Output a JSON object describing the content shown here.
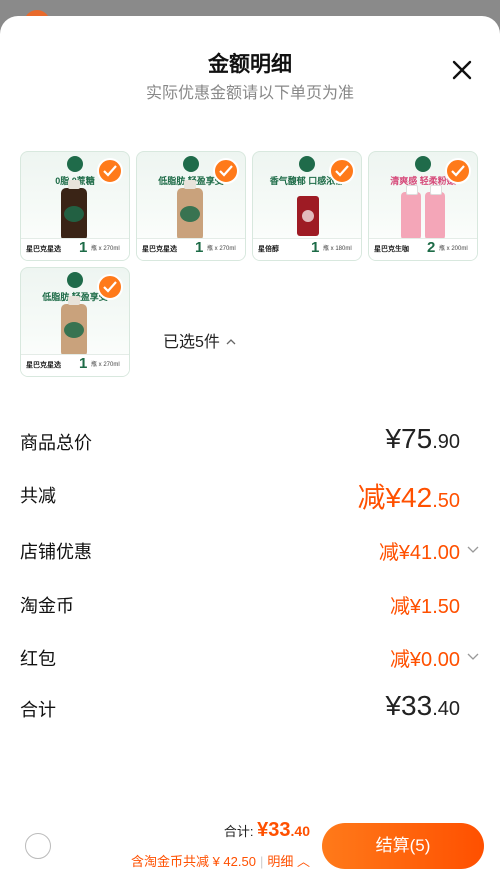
{
  "header": {
    "title": "金额明细",
    "subtitle": "实际优惠金额请以下单页为准",
    "close_icon": "close-icon"
  },
  "products": [
    {
      "banner": "0脂 0蔗糖",
      "brand": "星巴克星选",
      "qty": "1",
      "spec": "瓶 x 270ml",
      "color": "#3a2416"
    },
    {
      "banner": "低脂肪 轻盈享受",
      "brand": "星巴克星选",
      "qty": "1",
      "spec": "瓶 x 270ml",
      "color": "#c9a27c"
    },
    {
      "banner": "香气馥郁 口感浓郁",
      "brand": "星倍醇",
      "qty": "1",
      "spec": "瓶 x 180ml",
      "color": "#9e1b24"
    },
    {
      "banner": "清爽感 轻柔粉嫩",
      "brand": "星巴克生咖",
      "qty": "2",
      "spec": "瓶 x 200ml",
      "color": "#f4a6b8"
    },
    {
      "banner": "低脂肪 轻盈享受",
      "brand": "星巴克星选",
      "qty": "1",
      "spec": "瓶 x 270ml",
      "color": "#c9a27c"
    }
  ],
  "selected_text": "已选5件",
  "summary": {
    "goods_total": {
      "label": "商品总价",
      "int": "¥75",
      "dec": ".90"
    },
    "total_discount": {
      "label": "共减",
      "int": "减¥42",
      "dec": ".50"
    },
    "store_discount": {
      "label": "店铺优惠",
      "int": "减¥41",
      "dec": ".00"
    },
    "taojinbi": {
      "label": "淘金币",
      "int": "减¥1",
      "dec": ".50"
    },
    "red_packet": {
      "label": "红包",
      "int": "减¥0",
      "dec": ".00"
    },
    "total": {
      "label": "合计",
      "int": "¥33",
      "dec": ".40"
    }
  },
  "footer": {
    "total_label": "合计:",
    "total_int": "¥33",
    "total_dec": ".40",
    "discount_text": "含淘金币共减 ¥ 42.50",
    "detail_link": "明细",
    "checkout_label": "结算(5)"
  },
  "colors": {
    "accent": "#ff5000",
    "check": "#ff7a1a",
    "brand_green": "#1d6b47"
  }
}
